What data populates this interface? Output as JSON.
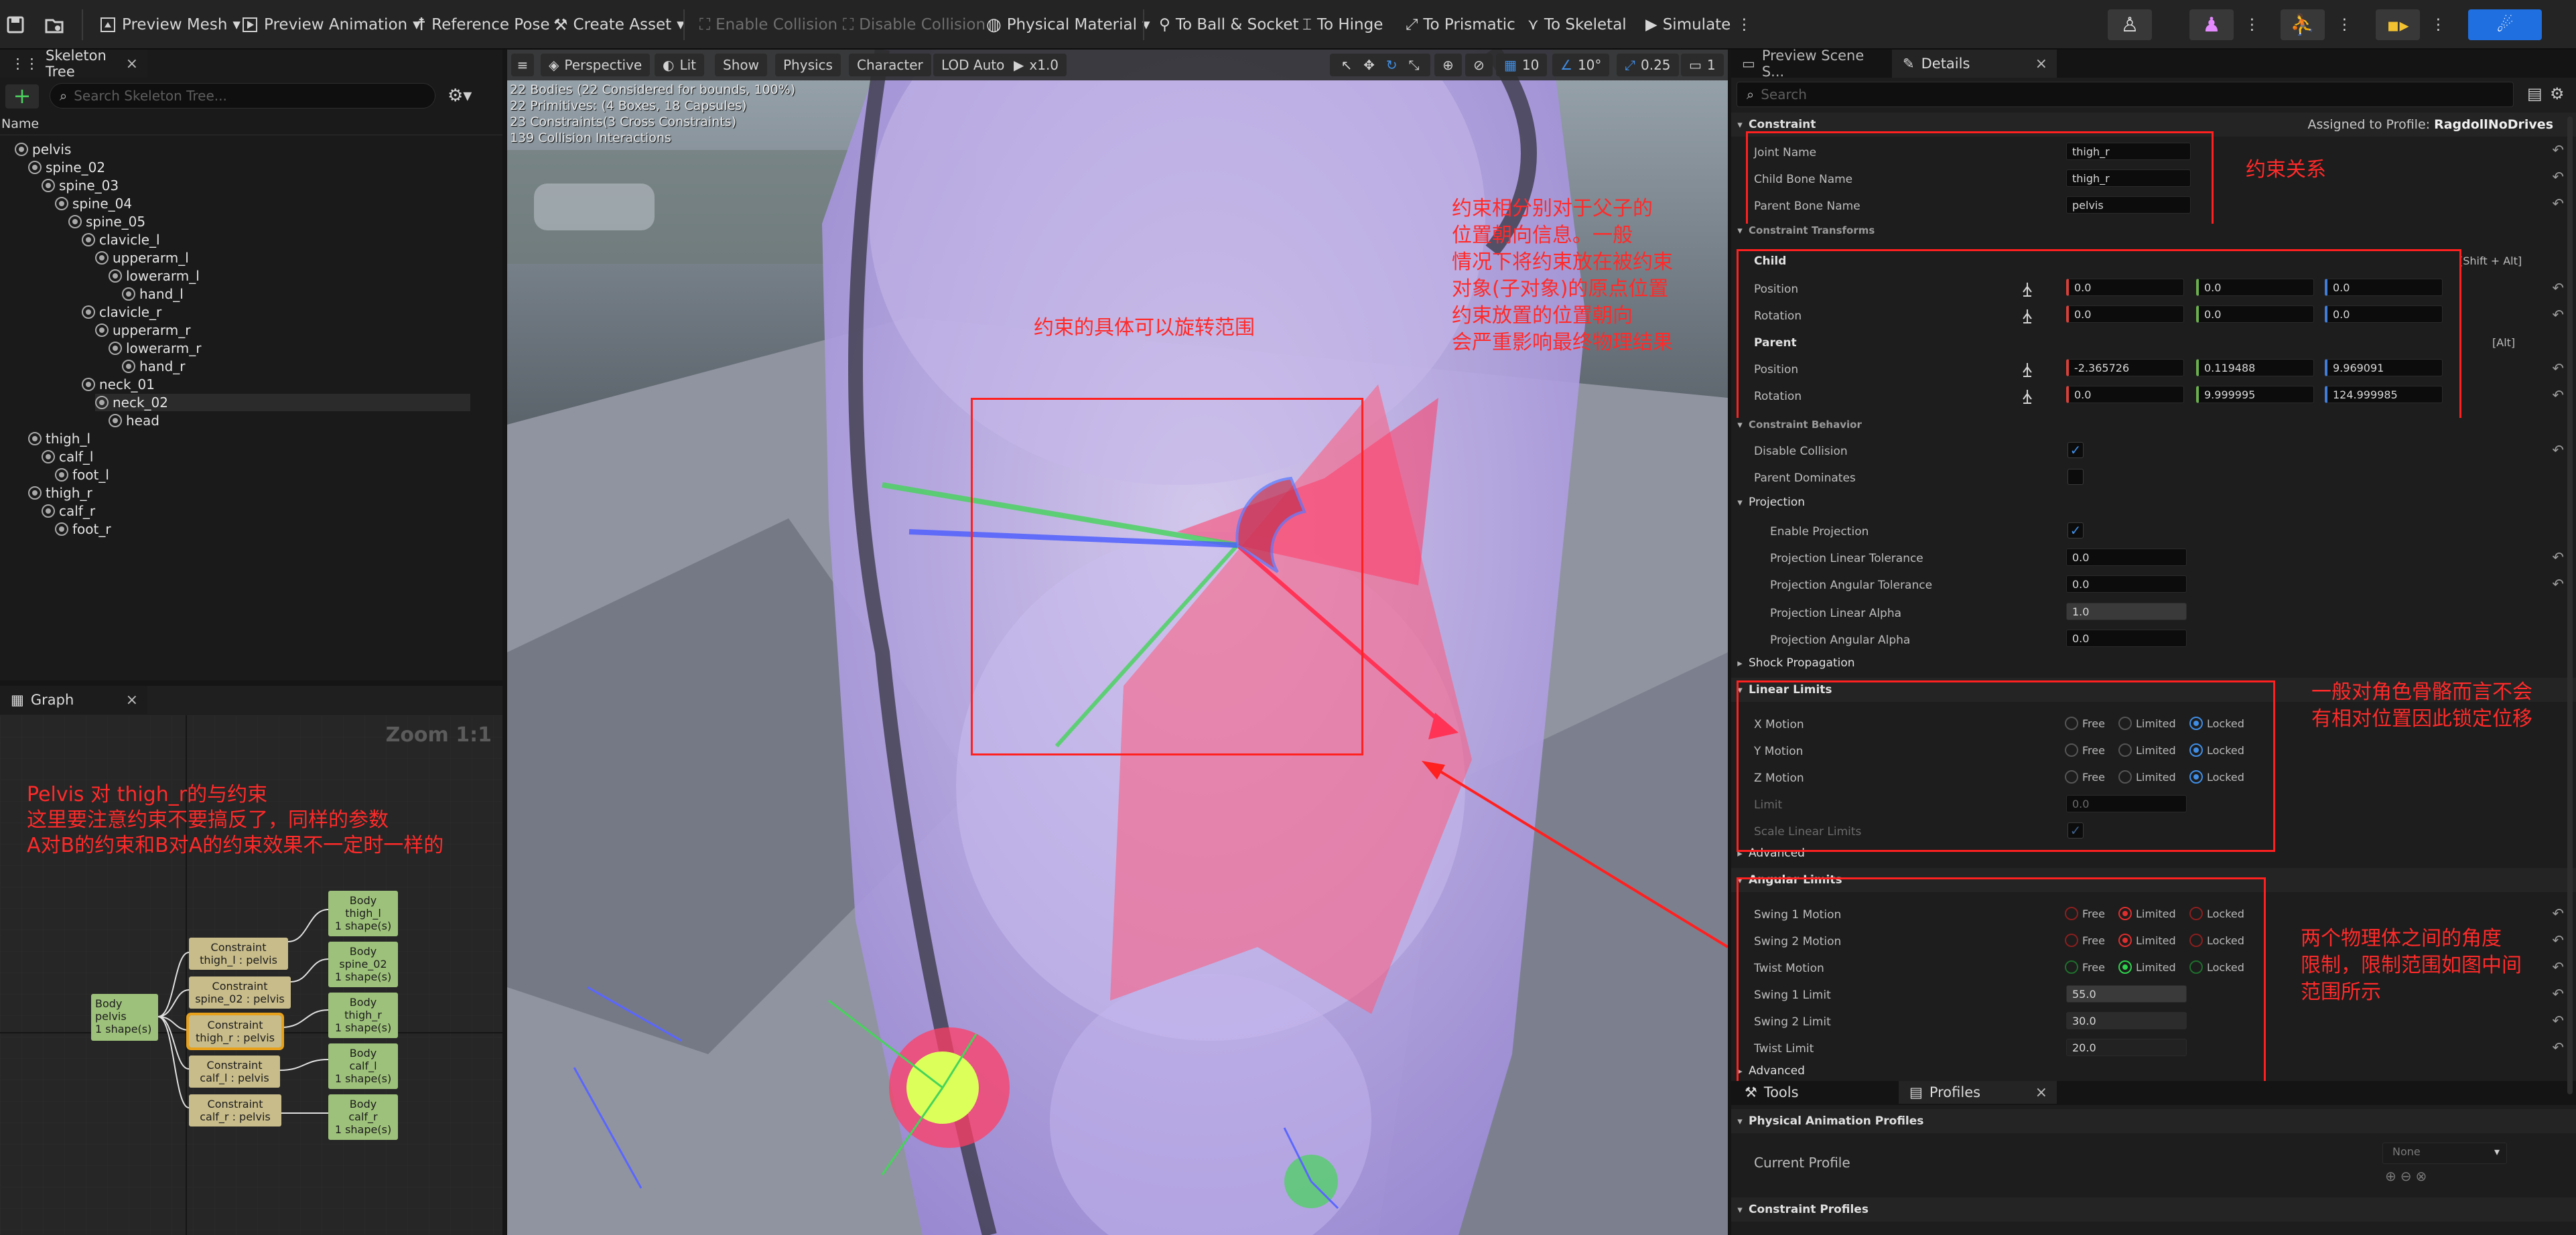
{
  "toolbar": {
    "preview_mesh": "Preview Mesh",
    "preview_animation": "Preview Animation",
    "reference_pose": "Reference Pose",
    "create_asset": "Create Asset",
    "enable_collision": "Enable Collision",
    "disable_collision": "Disable Collision",
    "physical_material": "Physical Material",
    "to_ball_socket": "To Ball & Socket",
    "to_hinge": "To Hinge",
    "to_prismatic": "To Prismatic",
    "to_skeletal": "To Skeletal",
    "simulate": "Simulate"
  },
  "skeleton_tree": {
    "tab": "Skeleton Tree",
    "search_placeholder": "Search Skeleton Tree...",
    "column_name": "Name",
    "bones": [
      {
        "name": "pelvis",
        "depth": 1
      },
      {
        "name": "spine_02",
        "depth": 2
      },
      {
        "name": "spine_03",
        "depth": 3
      },
      {
        "name": "spine_04",
        "depth": 4
      },
      {
        "name": "spine_05",
        "depth": 5
      },
      {
        "name": "clavicle_l",
        "depth": 6
      },
      {
        "name": "upperarm_l",
        "depth": 7
      },
      {
        "name": "lowerarm_l",
        "depth": 8
      },
      {
        "name": "hand_l",
        "depth": 9
      },
      {
        "name": "clavicle_r",
        "depth": 6
      },
      {
        "name": "upperarm_r",
        "depth": 7
      },
      {
        "name": "lowerarm_r",
        "depth": 8
      },
      {
        "name": "hand_r",
        "depth": 9
      },
      {
        "name": "neck_01",
        "depth": 6
      },
      {
        "name": "neck_02",
        "depth": 7
      },
      {
        "name": "head",
        "depth": 8
      },
      {
        "name": "thigh_l",
        "depth": 2
      },
      {
        "name": "calf_l",
        "depth": 3
      },
      {
        "name": "foot_l",
        "depth": 4
      },
      {
        "name": "thigh_r",
        "depth": 2
      },
      {
        "name": "calf_r",
        "depth": 3
      },
      {
        "name": "foot_r",
        "depth": 4
      }
    ]
  },
  "graph": {
    "tab": "Graph",
    "zoom": "Zoom 1:1",
    "annotation": "Pelvis 对 thigh_r的与约束\n这里要注意约束不要搞反了，同样的参数\nA对B的约束和B对A的约束效果不一定时一样的",
    "nodes": {
      "body_pelvis": "Body\npelvis\n1 shape(s)",
      "con_thigh_l": "Constraint\nthigh_l : pelvis",
      "con_spine_02": "Constraint\nspine_02 : pelvis",
      "con_thigh_r": "Constraint\nthigh_r : pelvis",
      "con_calf_l": "Constraint\ncalf_l : pelvis",
      "con_calf_r": "Constraint\ncalf_r : pelvis",
      "body_thigh_l": "Body\nthigh_l\n1 shape(s)",
      "body_spine_02": "Body\nspine_02\n1 shape(s)",
      "body_thigh_r": "Body\nthigh_r\n1 shape(s)",
      "body_calf_l": "Body\ncalf_l\n1 shape(s)",
      "body_calf_r": "Body\ncalf_r\n1 shape(s)"
    }
  },
  "viewport": {
    "perspective": "Perspective",
    "lit": "Lit",
    "show": "Show",
    "physics": "Physics",
    "character": "Character",
    "lod": "LOD Auto",
    "speed": "x1.0",
    "grid_size": "10",
    "rot_snap": "10°",
    "scale_snap": "0.25",
    "cam_speed": "1",
    "stats": [
      "22 Bodies (22 Considered for bounds, 100%)",
      "22 Primitives: (4 Boxes, 18 Capsules)",
      "23 Constraints(3 Cross Constraints)",
      "139 Collision Interactions"
    ],
    "annotation_range": "约束的具体可以旋转范围",
    "annotation_transform": "约束相分别对于父子的\n位置朝向信息。一般\n情况下将约束放在被约束\n对象(子对象)的原点位置\n约束放置的位置朝向\n会严重影响最终物理结果"
  },
  "details": {
    "tab_preview": "Preview Scene S...",
    "tab_details": "Details",
    "search_placeholder": "Search",
    "constraint_cat": "Constraint",
    "assigned_label": "Assigned to Profile:",
    "assigned_value": "RagdollNoDrives",
    "joint_name_label": "Joint Name",
    "joint_name": "thigh_r",
    "child_bone_label": "Child Bone Name",
    "child_bone": "thigh_r",
    "parent_bone_label": "Parent Bone Name",
    "parent_bone": "pelvis",
    "annotation_relation": "约束关系",
    "transforms_cat": "Constraint Transforms",
    "child_label": "Child",
    "child_hint": "[Shift + Alt]",
    "parent_label": "Parent",
    "parent_hint": "[Alt]",
    "position_label": "Position",
    "rotation_label": "Rotation",
    "child_position": [
      "0.0",
      "0.0",
      "0.0"
    ],
    "child_rotation": [
      "0.0",
      "0.0",
      "0.0"
    ],
    "parent_position": [
      "-2.365726",
      "0.119488",
      "9.969091"
    ],
    "parent_rotation": [
      "0.0",
      "9.999995",
      "124.999985"
    ],
    "behavior_cat": "Constraint Behavior",
    "disable_collision": "Disable Collision",
    "parent_dominates": "Parent Dominates",
    "projection_cat": "Projection",
    "enable_projection": "Enable Projection",
    "proj_linear_tol_label": "Projection Linear Tolerance",
    "proj_linear_tol": "0.0",
    "proj_angular_tol_label": "Projection Angular Tolerance",
    "proj_angular_tol": "0.0",
    "proj_linear_alpha_label": "Projection Linear Alpha",
    "proj_linear_alpha": "1.0",
    "proj_angular_alpha_label": "Projection Angular Alpha",
    "proj_angular_alpha": "0.0",
    "shock_propagation": "Shock Propagation",
    "linear_limits_cat": "Linear Limits",
    "x_motion": "X Motion",
    "y_motion": "Y Motion",
    "z_motion": "Z Motion",
    "opt_free": "Free",
    "opt_limited": "Limited",
    "opt_locked": "Locked",
    "limit_label": "Limit",
    "limit_value": "0.0",
    "scale_linear_limits": "Scale Linear Limits",
    "advanced": "Advanced",
    "annotation_linear": "一般对角色骨骼而言不会\n有相对位置因此锁定位移",
    "angular_limits_cat": "Angular Limits",
    "swing1_motion": "Swing 1 Motion",
    "swing2_motion": "Swing 2 Motion",
    "twist_motion": "Twist Motion",
    "swing1_limit_label": "Swing 1 Limit",
    "swing1_limit": "55.0",
    "swing2_limit_label": "Swing 2 Limit",
    "swing2_limit": "30.0",
    "twist_limit_label": "Twist Limit",
    "twist_limit": "20.0",
    "annotation_angular": "两个物理体之间的角度\n限制，限制范围如图中间\n范围所示"
  },
  "bottom": {
    "tab_tools": "Tools",
    "tab_profiles": "Profiles",
    "phys_anim_cat": "Physical Animation Profiles",
    "current_profile_label": "Current Profile",
    "current_profile": "None",
    "constraint_profiles_cat": "Constraint Profiles"
  },
  "colors": {
    "annotation_red": "#ff2a2a",
    "accent_blue": "#1f6fe0",
    "body_node": "#9dc17a",
    "constraint_node": "#c8bc8a",
    "selected_outline": "#e8a11b"
  }
}
